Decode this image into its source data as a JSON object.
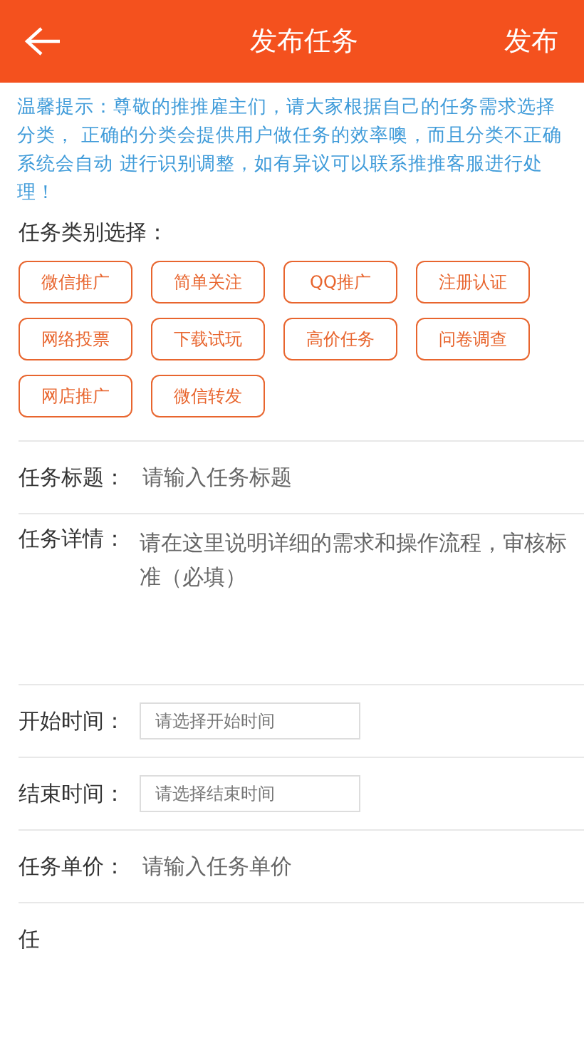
{
  "header": {
    "title": "发布任务",
    "action": "发布"
  },
  "notice": "温馨提示：尊敬的推推雇主们，请大家根据自己的任务需求选择分类， 正确的分类会提供用户做任务的效率噢，而且分类不正确系统会自动 进行识别调整，如有异议可以联系推推客服进行处理！",
  "category_label": "任务类别选择：",
  "categories": [
    {
      "label": "微信推广",
      "selected": false
    },
    {
      "label": "简单关注",
      "selected": false
    },
    {
      "label": "QQ推广",
      "selected": false
    },
    {
      "label": "注册认证",
      "selected": false
    },
    {
      "label": "网络投票",
      "selected": false
    },
    {
      "label": "下载试玩",
      "selected": false
    },
    {
      "label": "高价任务",
      "selected": false
    },
    {
      "label": "问卷调查",
      "selected": false
    },
    {
      "label": "网店推广",
      "selected": false
    },
    {
      "label": "微信转发",
      "selected": false
    }
  ],
  "fields": [
    {
      "kind": "text",
      "label": "任务标题：",
      "placeholder": "请输入任务标题"
    },
    {
      "kind": "area",
      "label": "任务详情：",
      "placeholder": "请在这里说明详细的需求和操作流程，审核标准（必填）"
    },
    {
      "kind": "date",
      "label": "开始时间：",
      "placeholder": "请选择开始时间"
    },
    {
      "kind": "date",
      "label": "结束时间：",
      "placeholder": "请选择结束时间"
    },
    {
      "kind": "text",
      "label": "任务单价：",
      "placeholder": "请输入任务单价"
    },
    {
      "kind": "cut",
      "label": "任"
    }
  ]
}
